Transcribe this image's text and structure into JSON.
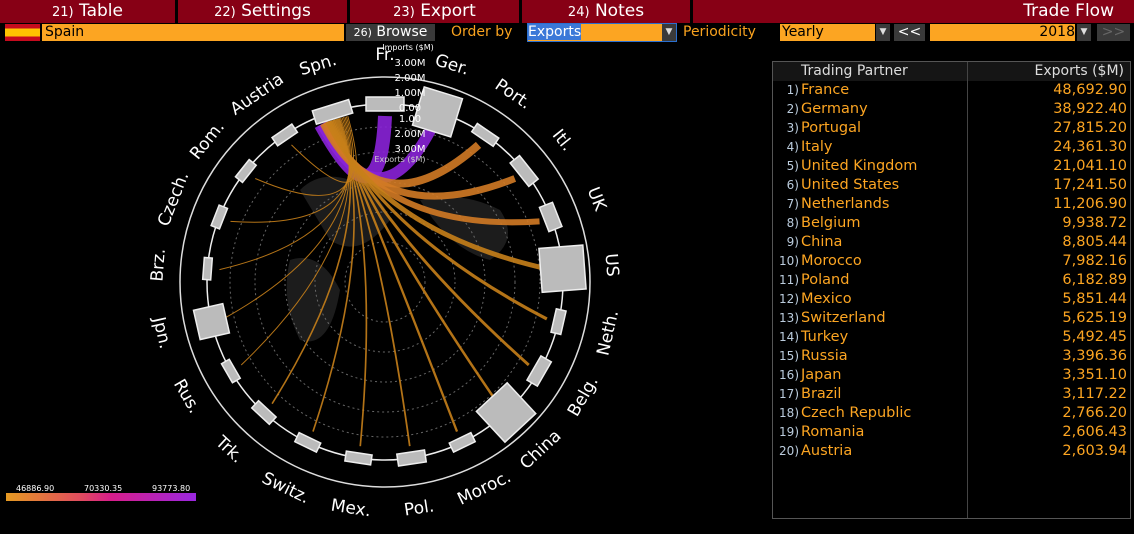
{
  "tabs": [
    {
      "num": "21)",
      "label": "Table"
    },
    {
      "num": "22)",
      "label": "Settings"
    },
    {
      "num": "23)",
      "label": "Export"
    },
    {
      "num": "24)",
      "label": "Notes"
    }
  ],
  "title": "Trade Flow",
  "toolbar": {
    "country": "Spain",
    "browse_num": "26)",
    "browse_label": "Browse",
    "order_by_label": "Order by",
    "order_by_value": "Exports",
    "periodicity_label": "Periodicity",
    "periodicity_value": "Yearly",
    "prev": "<<",
    "year": "2018",
    "next": ">>"
  },
  "chart": {
    "nodes": [
      "Fr.",
      "Ger.",
      "Port.",
      "Itl.",
      "UK",
      "US",
      "Neth.",
      "Belg.",
      "China",
      "Moroc.",
      "Pol.",
      "Mex.",
      "Switz.",
      "Trk.",
      "Rus.",
      "Jpn.",
      "Brz.",
      "Czech.",
      "Rom.",
      "Austria",
      "Spn."
    ],
    "axis_top_title": "Imports ($M)",
    "axis_bottom_title": "Exports ($M)",
    "axis_ticks_top": [
      "3.00M",
      "2.00M",
      "1.00M",
      "0.00"
    ],
    "axis_ticks_bottom": [
      "1.00",
      "2.00M",
      "3.00M"
    ],
    "legend": [
      "46886.90",
      "70330.35",
      "93773.80"
    ],
    "colors": {
      "low": "#e59a22",
      "high": "#9a27e0"
    }
  },
  "table": {
    "headers": [
      "Trading Partner",
      "Exports ($M)"
    ],
    "rows": [
      {
        "n": "1)",
        "country": "France",
        "value": "48,692.90"
      },
      {
        "n": "2)",
        "country": "Germany",
        "value": "38,922.40"
      },
      {
        "n": "3)",
        "country": "Portugal",
        "value": "27,815.20"
      },
      {
        "n": "4)",
        "country": "Italy",
        "value": "24,361.30"
      },
      {
        "n": "5)",
        "country": "United Kingdom",
        "value": "21,041.10"
      },
      {
        "n": "6)",
        "country": "United States",
        "value": "17,241.50"
      },
      {
        "n": "7)",
        "country": "Netherlands",
        "value": "11,206.90"
      },
      {
        "n": "8)",
        "country": "Belgium",
        "value": "9,938.72"
      },
      {
        "n": "9)",
        "country": "China",
        "value": "8,805.44"
      },
      {
        "n": "10)",
        "country": "Morocco",
        "value": "7,982.16"
      },
      {
        "n": "11)",
        "country": "Poland",
        "value": "6,182.89"
      },
      {
        "n": "12)",
        "country": "Mexico",
        "value": "5,851.44"
      },
      {
        "n": "13)",
        "country": "Switzerland",
        "value": "5,625.19"
      },
      {
        "n": "14)",
        "country": "Turkey",
        "value": "5,492.45"
      },
      {
        "n": "15)",
        "country": "Russia",
        "value": "3,396.36"
      },
      {
        "n": "16)",
        "country": "Japan",
        "value": "3,351.10"
      },
      {
        "n": "17)",
        "country": "Brazil",
        "value": "3,117.22"
      },
      {
        "n": "18)",
        "country": "Czech Republic",
        "value": "2,766.20"
      },
      {
        "n": "19)",
        "country": "Romania",
        "value": "2,606.43"
      },
      {
        "n": "20)",
        "country": "Austria",
        "value": "2,603.94"
      }
    ]
  }
}
